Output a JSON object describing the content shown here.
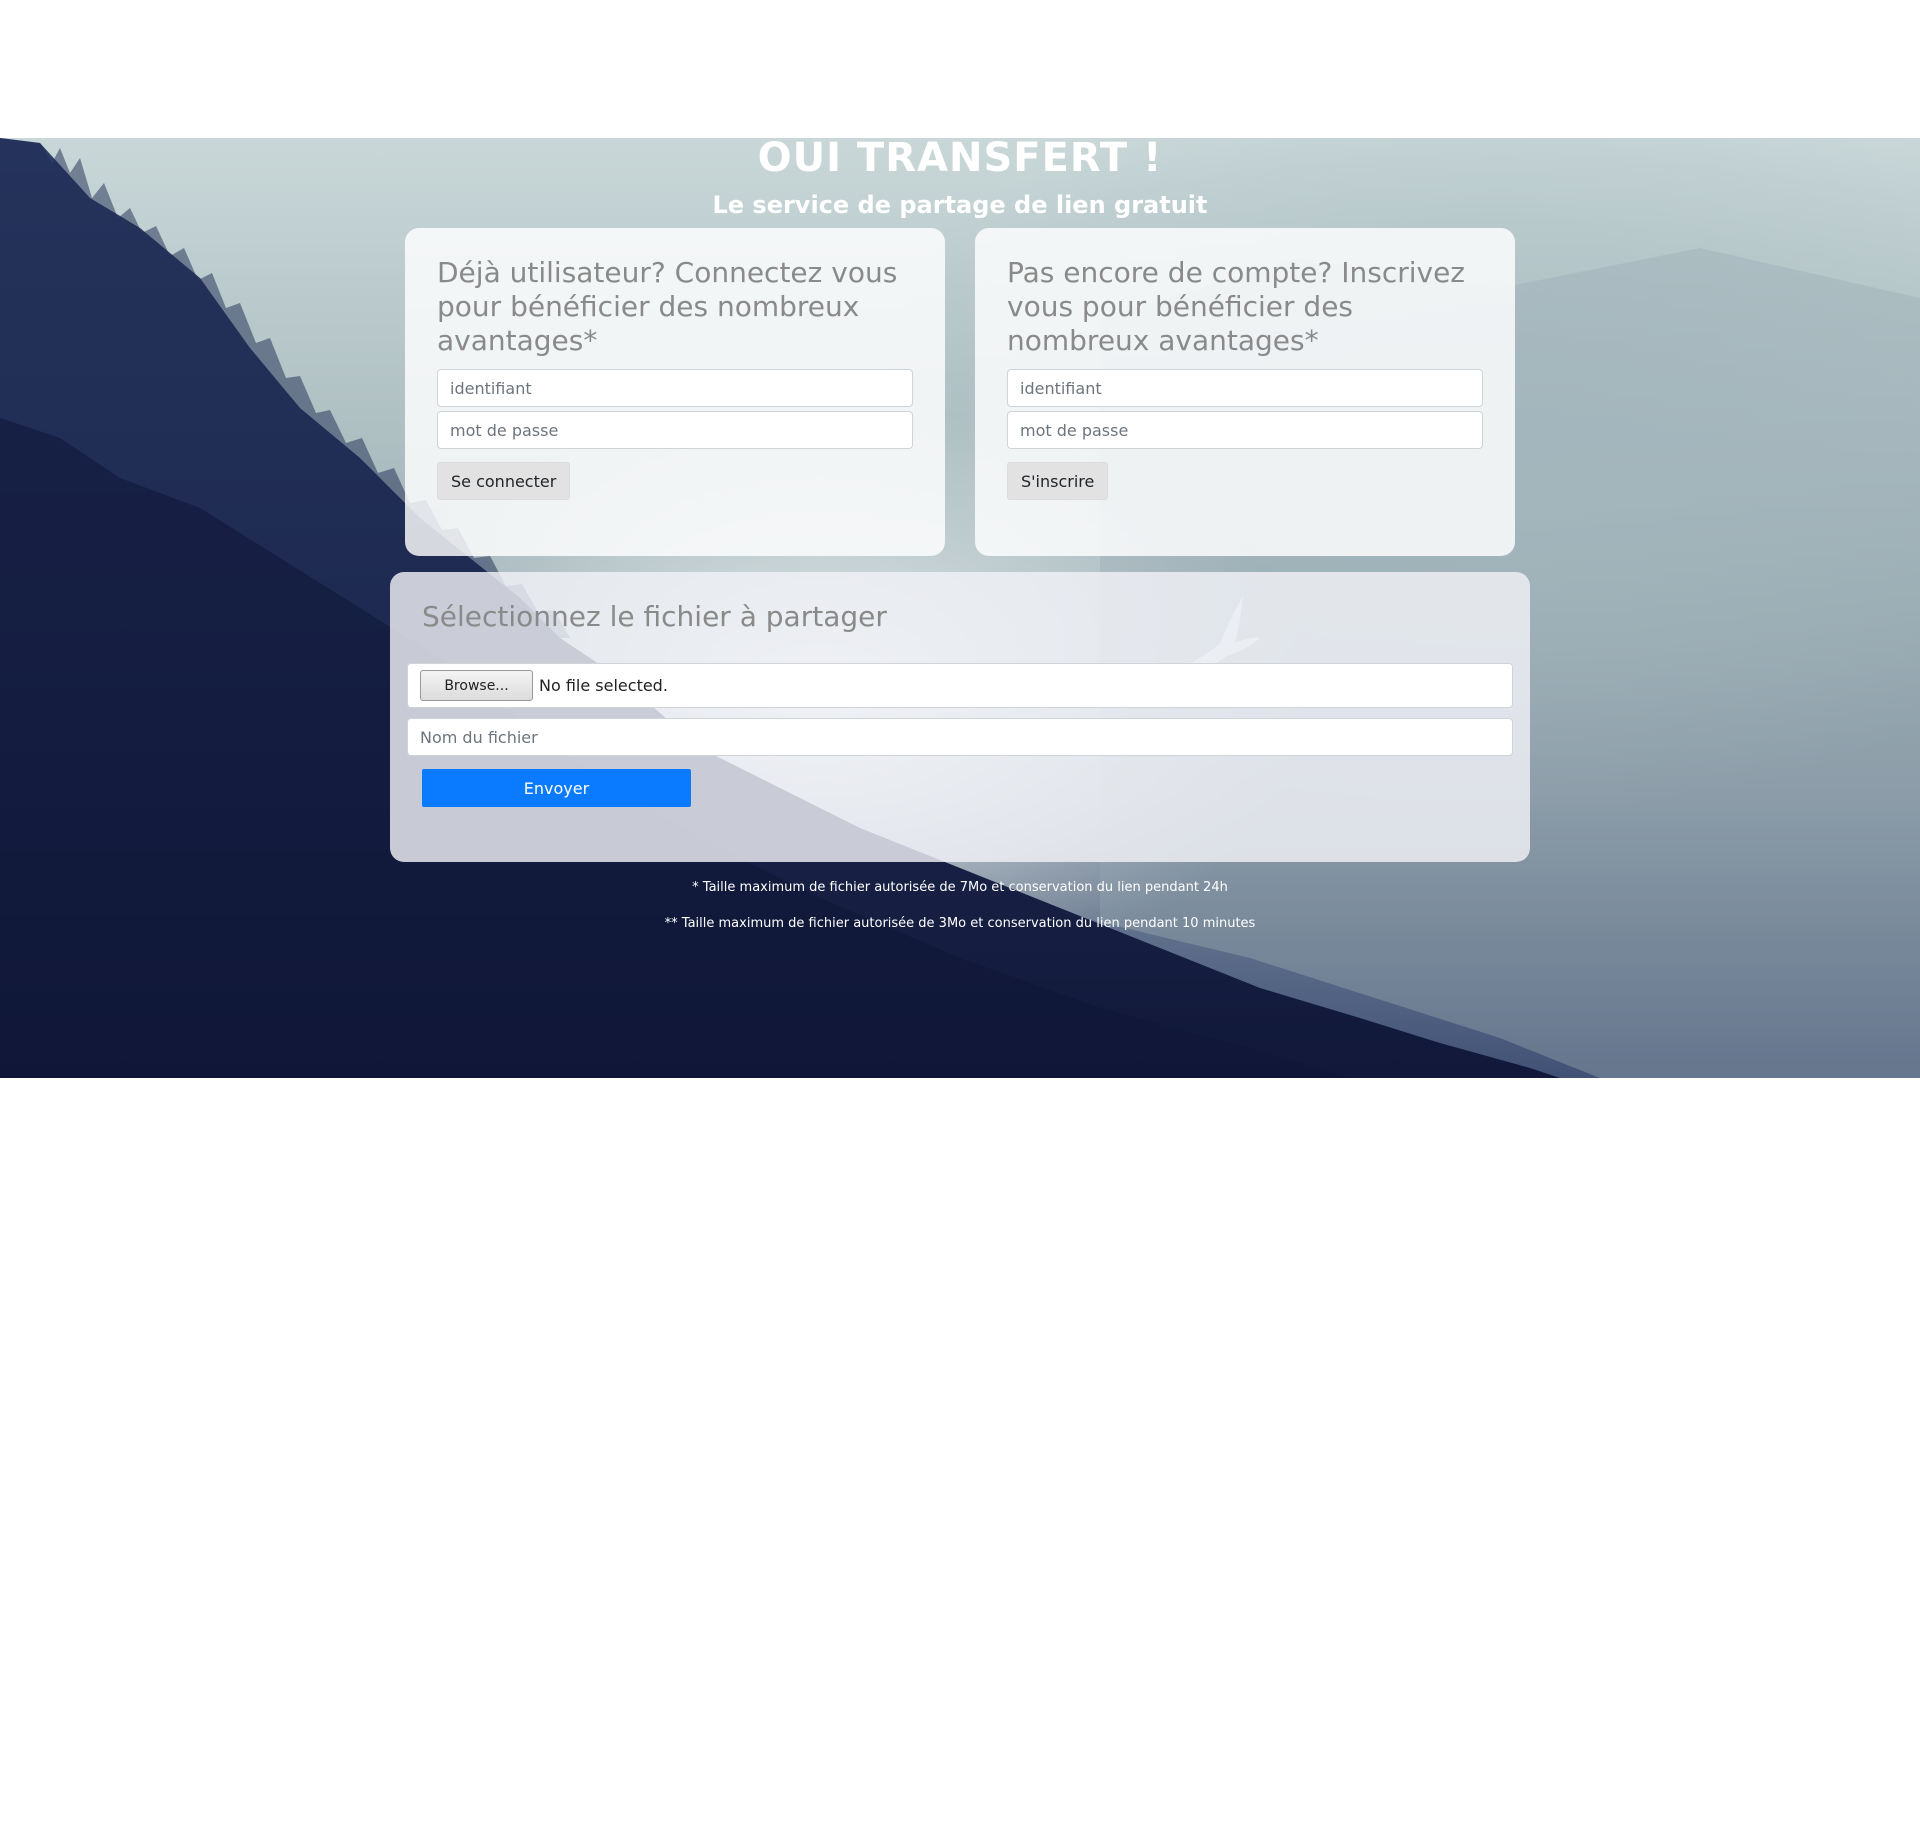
{
  "header": {
    "title": "OUI TRANSFERT !",
    "subtitle": "Le service de partage de lien gratuit"
  },
  "login": {
    "heading": "Déjà utilisateur? Connectez vous pour bénéficier des nombreux avantages*",
    "username_placeholder": "identifiant",
    "password_placeholder": "mot de passe",
    "button_label": "Se connecter"
  },
  "signup": {
    "heading": "Pas encore de compte? Inscrivez vous pour bénéficier des nombreux avantages*",
    "username_placeholder": "identifiant",
    "password_placeholder": "mot de passe",
    "button_label": "S'inscrire"
  },
  "upload": {
    "heading": "Sélectionnez le fichier à partager",
    "browse_label": "Browse...",
    "file_status": "No file selected.",
    "filename_placeholder": "Nom du fichier",
    "submit_label": "Envoyer"
  },
  "notes": {
    "registered": "* Taille maximum de fichier autorisée de 7Mo et conservation du lien pendant 24h",
    "anonymous": "** Taille maximum de fichier autorisée de 3Mo et conservation du lien pendant 10 minutes"
  },
  "colors": {
    "primary": "#0a7bff",
    "card_background": "#ffffff",
    "heading_text": "#8a8a8a"
  },
  "icons": {
    "background_decoration": "eagle-icon"
  }
}
